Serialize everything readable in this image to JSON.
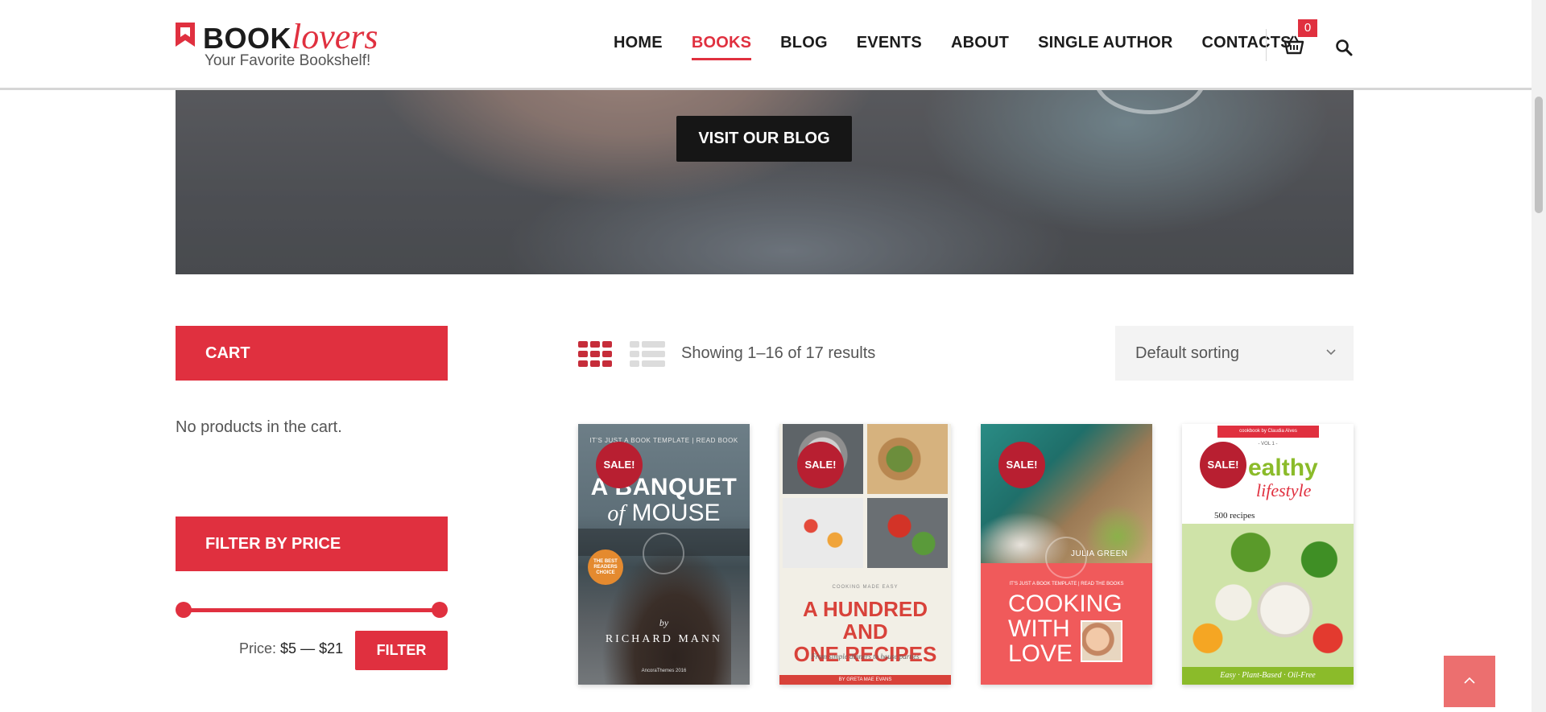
{
  "brand": {
    "name_bold": "BOOK",
    "name_italic": "lovers",
    "tagline": "Your Favorite Bookshelf!",
    "accent_color": "#e0303f"
  },
  "nav": {
    "items": [
      {
        "label": "HOME",
        "active": false
      },
      {
        "label": "BOOKS",
        "active": true
      },
      {
        "label": "BLOG",
        "active": false
      },
      {
        "label": "EVENTS",
        "active": false
      },
      {
        "label": "ABOUT",
        "active": false
      },
      {
        "label": "SINGLE AUTHOR",
        "active": false
      },
      {
        "label": "CONTACTS",
        "active": false
      }
    ],
    "cart_count": "0",
    "cart_icon": "basket-icon",
    "search_icon": "search-icon"
  },
  "hero": {
    "button_label": "VISIT OUR BLOG"
  },
  "sidebar": {
    "cart_title": "CART",
    "cart_empty": "No products in the cart.",
    "filter_title": "FILTER BY PRICE",
    "price_prefix": "Price:",
    "price_min": "$5",
    "price_sep": "—",
    "price_max": "$21",
    "filter_button": "FILTER"
  },
  "toolbar": {
    "grid_icon": "grid-view-icon",
    "list_icon": "list-view-icon",
    "result_count": "Showing 1–16 of 17 results",
    "sorting_selected": "Default sorting"
  },
  "products": [
    {
      "sale": "SALE!",
      "cover_top": "IT'S JUST A BOOK TEMPLATE  |  READ BOOK",
      "title_line1": "A BANQUET",
      "title_of": "of",
      "title_line2": "MOUSE",
      "badge": "THE BEST READERS CHOICE",
      "by": "by",
      "author": "RICHARD MANN",
      "footer": "AncoraThemes 2016"
    },
    {
      "sale": "SALE!",
      "small": "COOKING MADE EASY",
      "title_line1": "A HUNDRED AND",
      "title_line2": "ONE RECIPES",
      "subtitle": "From simple dinners to house parties",
      "footer": "BY GRETA MAE EVANS"
    },
    {
      "sale": "SALE!",
      "author_name": "JULIA GREEN",
      "small": "IT'S JUST A BOOK TEMPLATE  |  READ THE BOOKS",
      "title_line1": "COOKING",
      "title_line2": "WITH",
      "title_line3": "LOVE"
    },
    {
      "sale": "SALE!",
      "ribbon": "cookbook by Claudia Alves",
      "vol": "- VOL 1 -",
      "title_line1": "ealthy",
      "title_line2": "lifestyle",
      "recipes": "500 recipes",
      "footer": "Easy · Plant-Based · Oil-Free"
    }
  ],
  "scroll_top_icon": "chevron-up-icon"
}
